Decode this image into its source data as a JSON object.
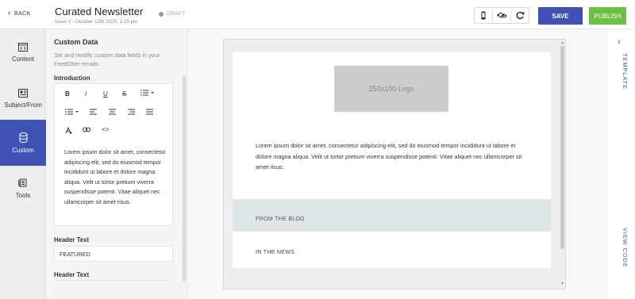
{
  "header": {
    "back_label": "BACK",
    "title": "Curated Newsletter",
    "subtitle": "Issue 2 - October 12th 2020, 1:25 pm",
    "status": "DRAFT",
    "save_label": "SAVE",
    "publish_label": "PUBLISH",
    "device_icons": [
      "mobile-icon",
      "desktop-icon",
      "refresh-icon"
    ]
  },
  "rail": {
    "items": [
      {
        "label": "Content",
        "icon": "code-icon",
        "active": false
      },
      {
        "label": "Subject/From",
        "icon": "newspaper-icon",
        "active": false
      },
      {
        "label": "Custom",
        "icon": "database-icon",
        "active": true
      },
      {
        "label": "Tools",
        "icon": "tools-icon",
        "active": false
      }
    ]
  },
  "panel": {
    "title": "Custom Data",
    "description": "Set and modify custom data fields in your FeedOtter emails.",
    "introduction_label": "Introduction",
    "intro_text": "Lorem ipsum dolor sit amet, consectetur adipiscing elit, sed do eiusmod tempor incididunt ut labore et dolore magna aliqua. Velit ut tortor pretium viverra suspendisse potenti. Vitae aliquet nec ullamcorper sit amet risus.",
    "header_text_label": "Header Text",
    "header_text_value": "FEATURED",
    "header_text_label_2": "Header Text",
    "toolbar": {
      "bold": "B",
      "italic": "I",
      "underline": "U",
      "strike": "S",
      "code": "<>"
    }
  },
  "email": {
    "logo_text": "250x100 Logo",
    "body_text": "Lorem ipsum dolor sit amet, consectetur adipiscing elit, sed do eiusmod tempor incididunt ut labore et dolore magna aliqua. Velit ut tortor pretium viverra suspendisse potenti. Vitae aliquet nec ullamcorper sit amet risus.",
    "blog_heading": "FROM THE BLOG",
    "news_heading": "IN THE NEWS"
  },
  "rightbar": {
    "template_label": "TEMPLATE",
    "view_code_label": "VIEW CODE"
  },
  "colors": {
    "primary": "#3f51b5",
    "publish": "#6cbf43",
    "band": "#dfe6e7"
  }
}
